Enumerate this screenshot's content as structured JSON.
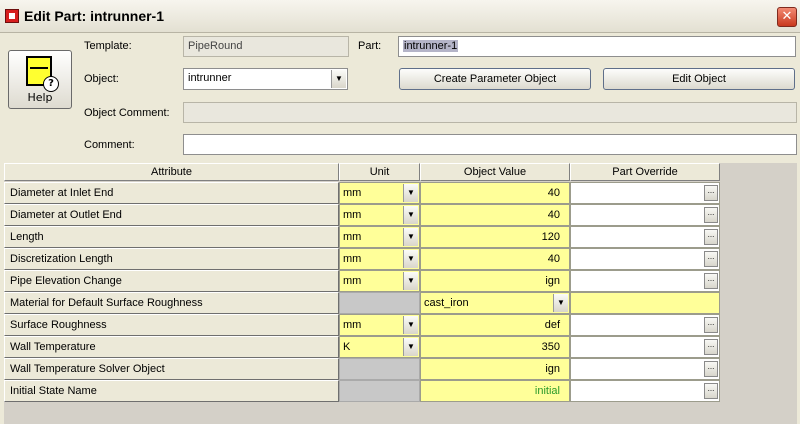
{
  "window": {
    "title": "Edit Part: intrunner-1",
    "close_glyph": "✕"
  },
  "help": {
    "label": "Help",
    "icon": "help-icon"
  },
  "form": {
    "template_label": "Template:",
    "template_value": "PipeRound",
    "part_label": "Part:",
    "part_value": "intrunner-1",
    "object_label": "Object:",
    "object_value": "intrunner",
    "object_comment_label": "Object Comment:",
    "object_comment_value": "",
    "comment_label": "Comment:",
    "comment_value": "",
    "create_button": "Create Parameter Object",
    "edit_button": "Edit Object"
  },
  "grid": {
    "headers": {
      "attribute": "Attribute",
      "unit": "Unit",
      "object_value": "Object Value",
      "part_override": "Part Override"
    },
    "rows": [
      {
        "attribute": "Diameter at Inlet End",
        "unit": "mm",
        "value": "40",
        "override": ""
      },
      {
        "attribute": "Diameter at Outlet End",
        "unit": "mm",
        "value": "40",
        "override": ""
      },
      {
        "attribute": "Length",
        "unit": "mm",
        "value": "120",
        "override": ""
      },
      {
        "attribute": "Discretization Length",
        "unit": "mm",
        "value": "40",
        "override": ""
      },
      {
        "attribute": "Pipe Elevation Change",
        "unit": "mm",
        "value": "ign",
        "override": ""
      },
      {
        "attribute": "Material for Default Surface Roughness",
        "unit": "",
        "value": "cast_iron",
        "override": ""
      },
      {
        "attribute": "Surface Roughness",
        "unit": "mm",
        "value": "def",
        "override": ""
      },
      {
        "attribute": "Wall Temperature",
        "unit": "K",
        "value": "350",
        "override": ""
      },
      {
        "attribute": "Wall Temperature Solver Object",
        "unit": "",
        "value": "ign",
        "override": ""
      },
      {
        "attribute": "Initial State Name",
        "unit": "",
        "value": "initial",
        "override": ""
      }
    ]
  },
  "colors": {
    "value_bg": "#ffff99",
    "initial_text": "#2a9a2a",
    "window_bg": "#ece9d8"
  }
}
